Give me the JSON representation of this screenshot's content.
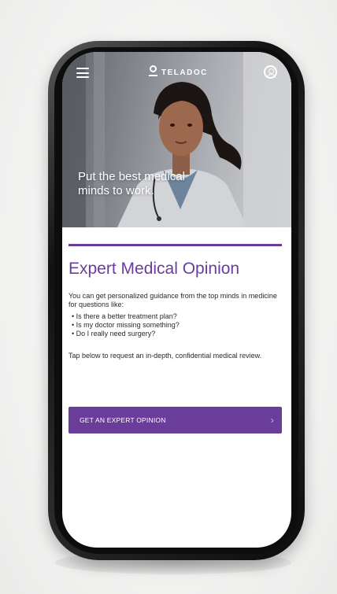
{
  "app": {
    "brand_name": "TELADOC"
  },
  "header": {
    "menu_icon": "hamburger-menu-icon",
    "account_icon": "user-account-icon"
  },
  "hero": {
    "tagline": "Put the best medical minds to work."
  },
  "main": {
    "title": "Expert Medical Opinion",
    "intro": "You can get personalized guidance from the top minds in medicine for questions like:",
    "questions": [
      "Is there a better treatment plan?",
      "Is my doctor missing something?",
      "Do I really need surgery?"
    ],
    "outro": "Tap below to request an in-depth, confidential medical review.",
    "cta_label": "GET AN EXPERT OPINION",
    "cta_arrow": "›"
  },
  "colors": {
    "accent": "#6a3d9a",
    "background": "#ffffff",
    "text": "#2a2a2a"
  }
}
